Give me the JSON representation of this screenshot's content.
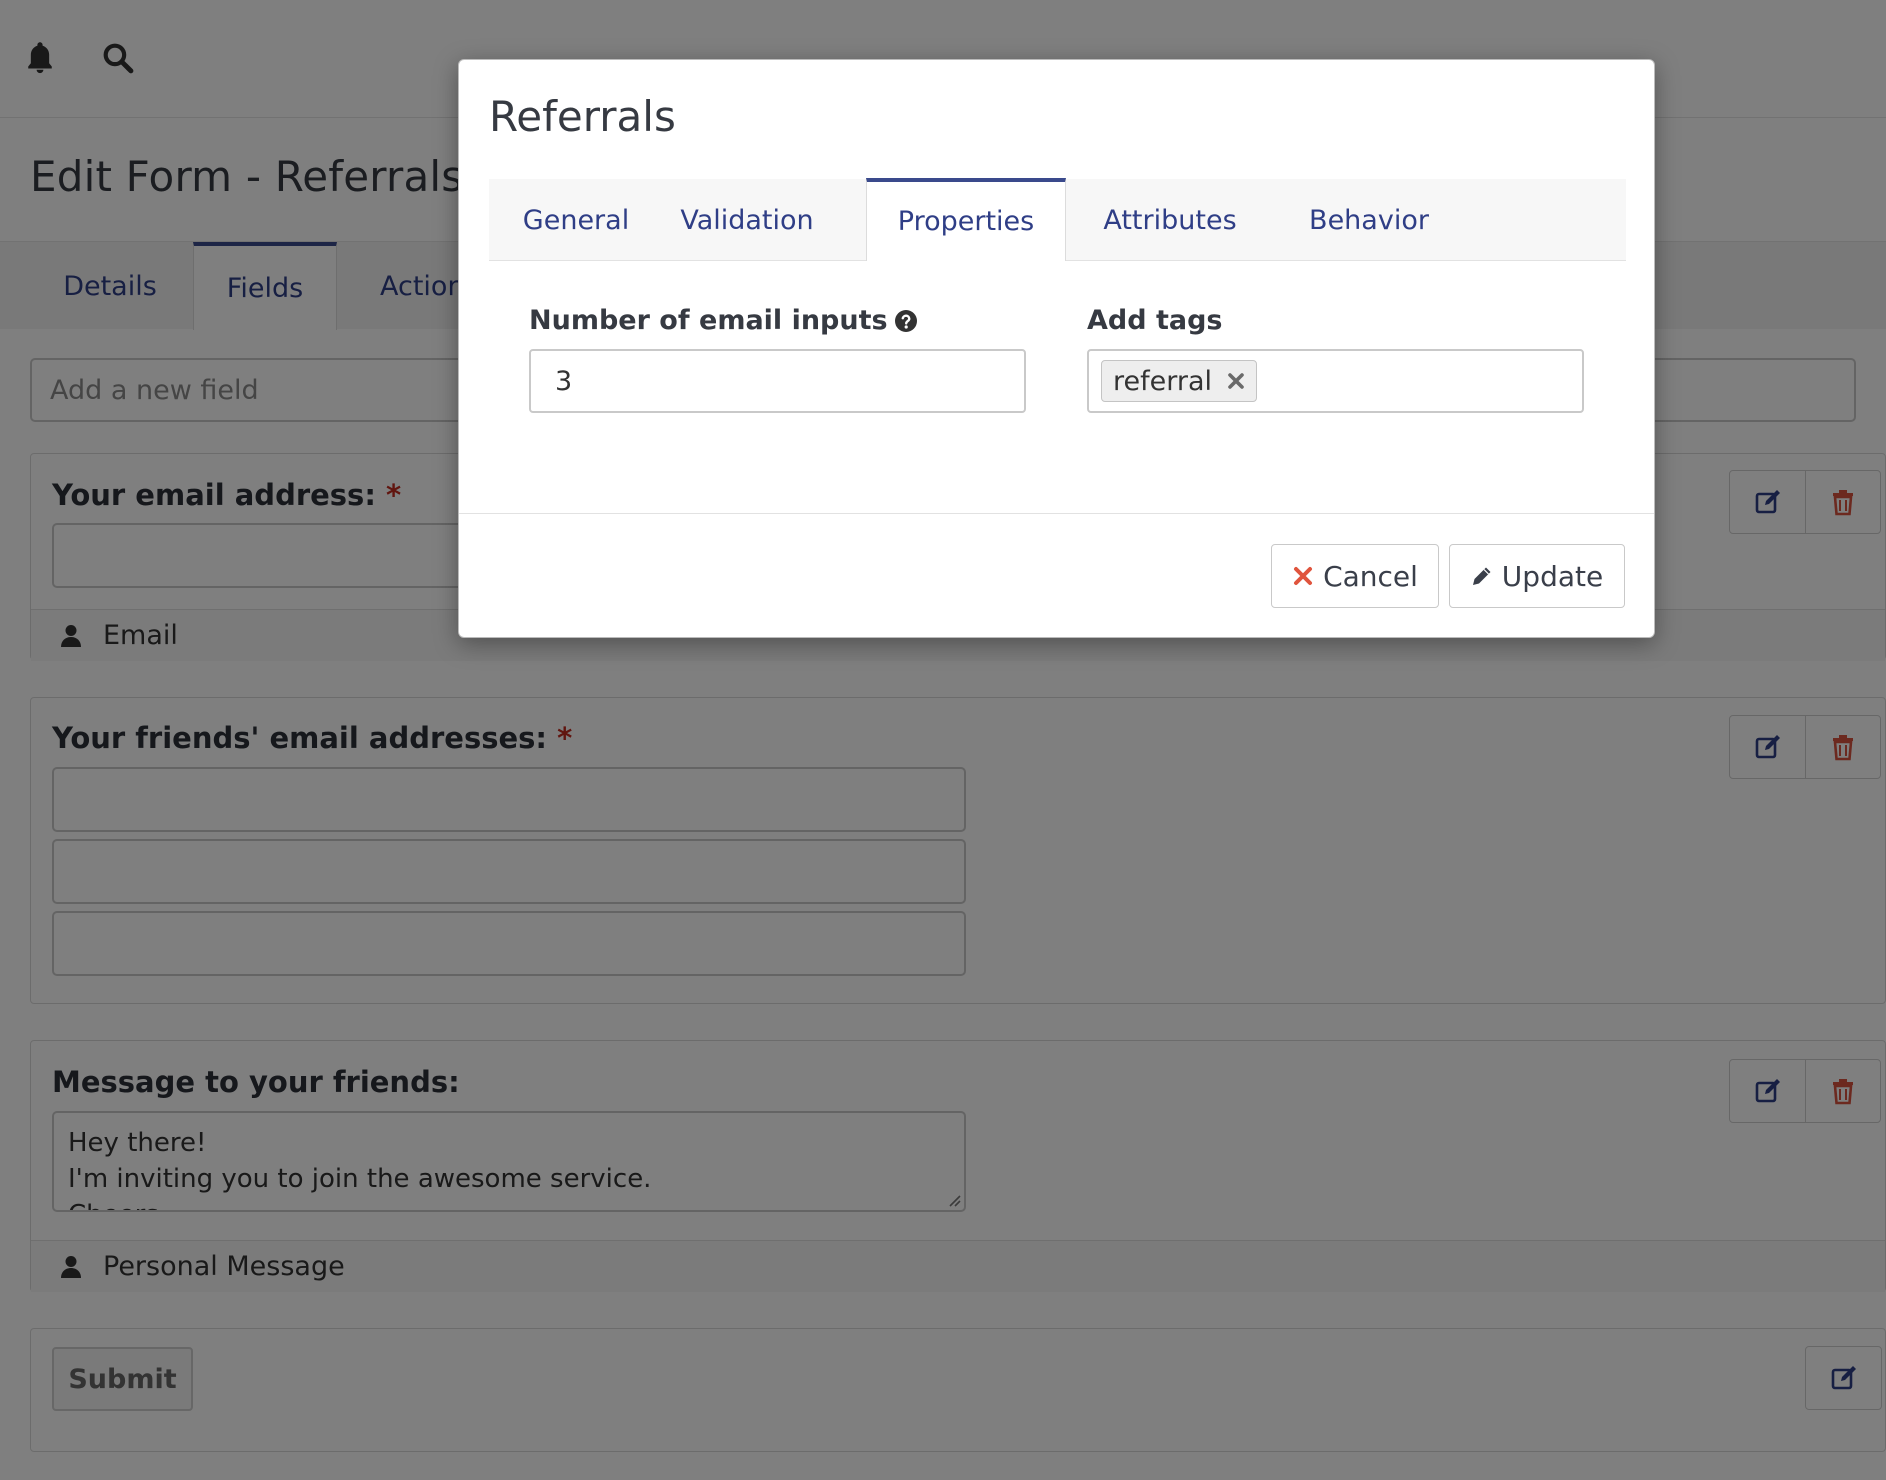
{
  "topbar": {
    "icons": [
      "bell-icon",
      "search-icon"
    ]
  },
  "page": {
    "title": "Edit Form - Referrals",
    "tabs": [
      {
        "label": "Details",
        "active": false
      },
      {
        "label": "Fields",
        "active": true
      },
      {
        "label": "Actions",
        "active": false
      }
    ],
    "add_field_placeholder": "Add a new field"
  },
  "fields": [
    {
      "label": "Your email address:",
      "required": "*",
      "footer": "Email",
      "footer_icon": "user-icon"
    },
    {
      "label": "Your friends' email addresses:",
      "required": "*"
    },
    {
      "label": "Message to your friends:",
      "message": "Hey there!\nI'm inviting you to join the awesome service.\nCheers",
      "footer": "Personal Message",
      "footer_icon": "user-icon"
    }
  ],
  "submit_label": "Submit",
  "modal": {
    "title": "Referrals",
    "tabs": [
      {
        "label": "General",
        "active": false
      },
      {
        "label": "Validation",
        "active": false
      },
      {
        "label": "Properties",
        "active": true
      },
      {
        "label": "Attributes",
        "active": false
      },
      {
        "label": "Behavior",
        "active": false
      }
    ],
    "email_inputs_label": "Number of email inputs",
    "email_inputs_value": "3",
    "add_tags_label": "Add tags",
    "tags": [
      "referral"
    ],
    "cancel_label": "Cancel",
    "update_label": "Update"
  },
  "colors": {
    "accent": "#2f3e86",
    "required": "#c22b1e",
    "danger": "#d9533e",
    "overlay": "rgba(0,0,0,0.5)"
  }
}
